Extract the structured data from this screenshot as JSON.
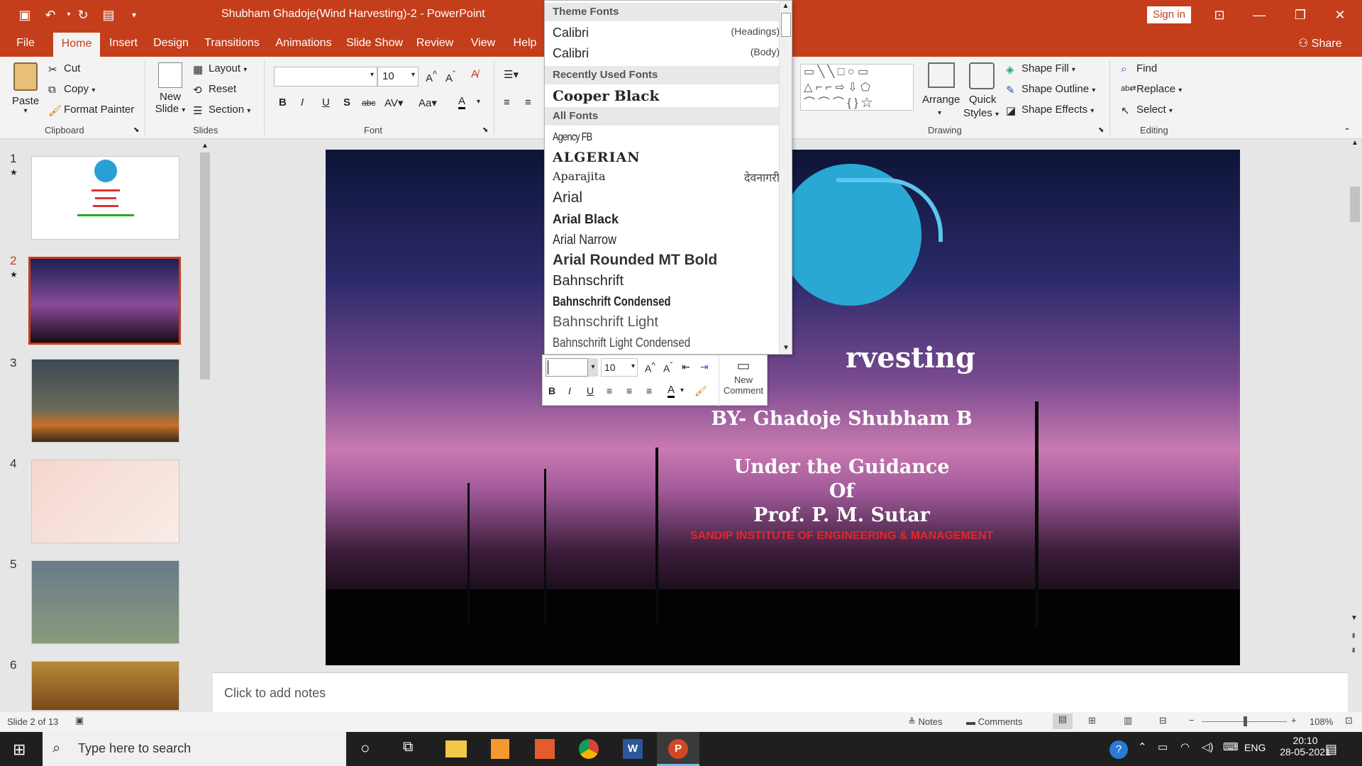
{
  "app": {
    "title": "Shubham Ghadoje(Wind Harvesting)-2  -  PowerPoint",
    "signin": "Sign in",
    "share": "Share"
  },
  "tabs": [
    "File",
    "Home",
    "Insert",
    "Design",
    "Transitions",
    "Animations",
    "Slide Show",
    "Review",
    "View",
    "Help"
  ],
  "ribbon": {
    "clipboard": {
      "paste": "Paste",
      "cut": "Cut",
      "copy": "Copy",
      "format_painter": "Format Painter",
      "label": "Clipboard"
    },
    "slides": {
      "new_slide_1": "New",
      "new_slide_2": "Slide",
      "layout": "Layout",
      "reset": "Reset",
      "section": "Section",
      "label": "Slides"
    },
    "font": {
      "font_size": "10",
      "label": "Font"
    },
    "drawing": {
      "arrange": "Arrange",
      "quick_styles_1": "Quick",
      "quick_styles_2": "Styles",
      "shape_fill": "Shape Fill",
      "shape_outline": "Shape Outline",
      "shape_effects": "Shape Effects",
      "label": "Drawing"
    },
    "editing": {
      "find": "Find",
      "replace": "Replace",
      "select": "Select",
      "label": "Editing"
    }
  },
  "thumbnails": [
    "1",
    "2",
    "3",
    "4",
    "5",
    "6"
  ],
  "font_dropdown": {
    "theme_header": "Theme Fonts",
    "theme": [
      {
        "name": "Calibri",
        "role": "(Headings)"
      },
      {
        "name": "Calibri",
        "role": "(Body)"
      }
    ],
    "recent_header": "Recently Used Fonts",
    "recent": [
      "Cooper Black"
    ],
    "all_header": "All Fonts",
    "all": [
      "Agency FB",
      "ALGERIAN",
      "Aparajita",
      "Arial",
      "Arial Black",
      "Arial Narrow",
      "Arial Rounded MT Bold",
      "Bahnschrift",
      "Bahnschrift Condensed",
      "Bahnschrift Light",
      "Bahnschrift Light Condensed"
    ],
    "aparajita_sample": "देवनागरी"
  },
  "mini_toolbar": {
    "size": "10",
    "new_comment_1": "New",
    "new_comment_2": "Comment"
  },
  "slide": {
    "title_fragment": "rvesting",
    "byline": "BY- Ghadoje Shubham B",
    "guidance": "Under the Guidance",
    "of": "Of",
    "guide": "Prof. P. M. Sutar",
    "institute": "SANDIP INSTITUTE OF ENGINEERING & MANAGEMENT"
  },
  "notes_placeholder": "Click to add notes",
  "status": {
    "slide_info": "Slide 2 of 13",
    "notes": "Notes",
    "comments": "Comments",
    "zoom": "108%"
  },
  "taskbar": {
    "search": "Type here to search",
    "lang": "ENG",
    "time": "20:10",
    "date": "28-05-2021"
  }
}
